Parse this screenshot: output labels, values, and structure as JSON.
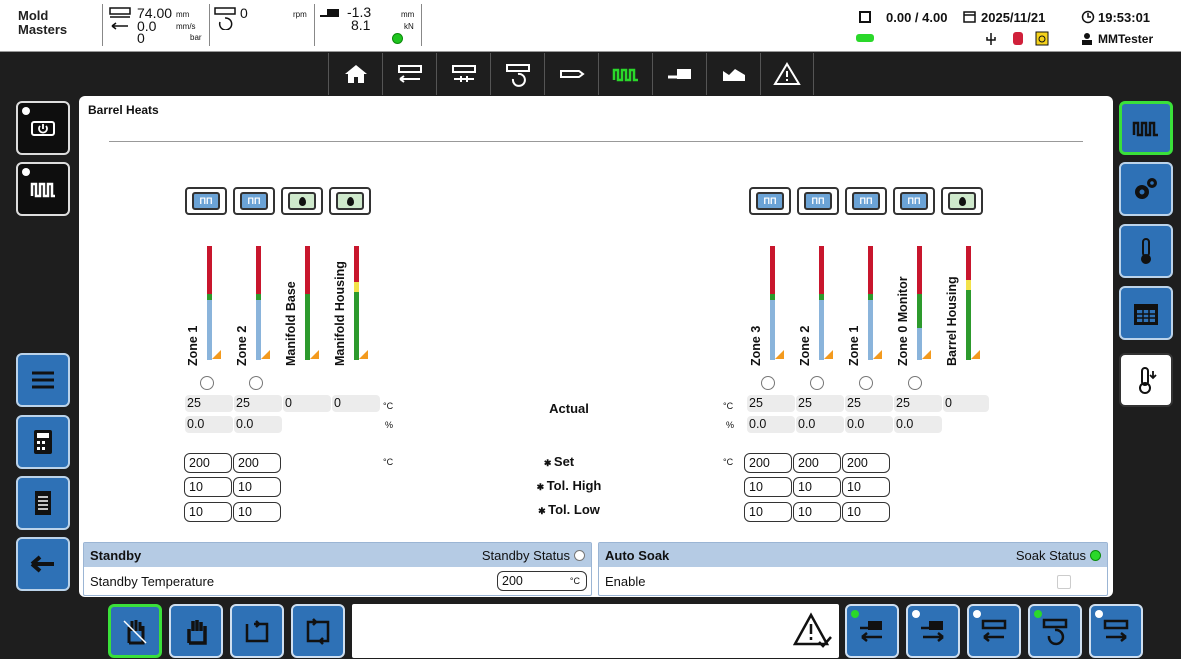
{
  "logo": {
    "line1": "Mold",
    "line2": "Masters"
  },
  "status": {
    "injection": {
      "position": "74.00",
      "speed": "0.0",
      "pressure": "0",
      "unit_pos": "mm",
      "unit_speed": "mm/s",
      "unit_pressure": "bar"
    },
    "screw": {
      "value": "0",
      "unit": "rpm"
    },
    "clamp": {
      "position": "-1.3",
      "force": "8.1",
      "unit_pos": "mm",
      "unit_force": "kN"
    },
    "cycle": "0.00 / 4.00",
    "date": "2025/11/21",
    "time": "19:53:01",
    "user": "MMTester"
  },
  "nav": [
    "home-icon",
    "inject-icon",
    "hold-icon",
    "plasticize-icon",
    "nozzle-icon",
    "barrel-heats-icon",
    "ejector-icon",
    "mold-icon",
    "alarm-icon"
  ],
  "page_title": "Barrel Heats",
  "left_zones": [
    {
      "name": "Zone 1",
      "icon": "heat",
      "actual": "25",
      "power": "0.0",
      "set": "200",
      "tol_high": "10",
      "tol_low": "10"
    },
    {
      "name": "Zone 2",
      "icon": "heat",
      "actual": "25",
      "power": "0.0",
      "set": "200",
      "tol_high": "10",
      "tol_low": "10"
    },
    {
      "name": "Manifold Base",
      "icon": "water",
      "actual": "0",
      "power": "",
      "set": "",
      "tol_high": "",
      "tol_low": ""
    },
    {
      "name": "Manifold Housing",
      "icon": "water",
      "actual": "0",
      "power": "",
      "set": "",
      "tol_high": "",
      "tol_low": ""
    }
  ],
  "right_zones": [
    {
      "name": "Zone 3",
      "icon": "heat",
      "actual": "25",
      "power": "0.0",
      "set": "200",
      "tol_high": "10",
      "tol_low": "10"
    },
    {
      "name": "Zone 2",
      "icon": "heat",
      "actual": "25",
      "power": "0.0",
      "set": "200",
      "tol_high": "10",
      "tol_low": "10"
    },
    {
      "name": "Zone 1",
      "icon": "heat",
      "actual": "25",
      "power": "0.0",
      "set": "200",
      "tol_high": "10",
      "tol_low": "10"
    },
    {
      "name": "Zone 0 Monitor",
      "icon": "heat",
      "actual": "25",
      "power": "0.0",
      "set": "",
      "tol_high": "",
      "tol_low": ""
    },
    {
      "name": "Barrel Housing",
      "icon": "water",
      "actual": "0",
      "power": "",
      "set": "",
      "tol_high": "",
      "tol_low": ""
    }
  ],
  "labels": {
    "actual": "Actual",
    "set": "Set",
    "tol_high": "Tol. High",
    "tol_low": "Tol. Low",
    "unit_c": "°C",
    "unit_pct": "%"
  },
  "standby": {
    "title": "Standby",
    "status_label": "Standby Status",
    "temp_label": "Standby Temperature",
    "temp_value": "200",
    "temp_unit": "°C"
  },
  "autosoak": {
    "title": "Auto Soak",
    "status_label": "Soak Status",
    "enable_label": "Enable"
  },
  "colors": {
    "accent_blue": "#2e71b6",
    "active_green": "#2ad82a",
    "alarm_red": "#c8162d"
  }
}
